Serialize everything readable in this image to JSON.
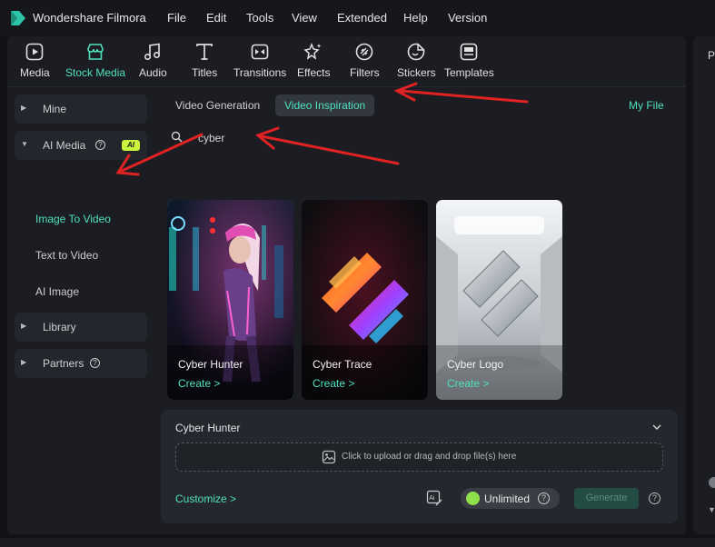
{
  "app": {
    "title": "Wondershare Filmora"
  },
  "menu": [
    "File",
    "Edit",
    "Tools",
    "View",
    "Extended",
    "Help",
    "Version"
  ],
  "toolbar": [
    {
      "label": "Media",
      "icon": "media-icon"
    },
    {
      "label": "Stock Media",
      "icon": "stock-media-icon",
      "active": true
    },
    {
      "label": "Audio",
      "icon": "audio-icon"
    },
    {
      "label": "Titles",
      "icon": "titles-icon"
    },
    {
      "label": "Transitions",
      "icon": "transitions-icon"
    },
    {
      "label": "Effects",
      "icon": "effects-icon"
    },
    {
      "label": "Filters",
      "icon": "filters-icon"
    },
    {
      "label": "Stickers",
      "icon": "stickers-icon"
    },
    {
      "label": "Templates",
      "icon": "templates-icon"
    }
  ],
  "sidebar": {
    "mine": "Mine",
    "ai_media": "AI Media",
    "ai_badge": "AI",
    "sub_items": [
      "Image To Video",
      "Text to Video",
      "AI Image"
    ],
    "library": "Library",
    "partners": "Partners"
  },
  "content": {
    "tabs": [
      "Video Generation",
      "Video Inspiration"
    ],
    "active_tab": "Video Inspiration",
    "my_file": "My File",
    "search_value": "cyber",
    "cards": [
      {
        "title": "Cyber Hunter",
        "action": "Create >"
      },
      {
        "title": "Cyber Trace",
        "action": "Create >"
      },
      {
        "title": "Cyber Logo",
        "action": "Create >"
      }
    ]
  },
  "generator": {
    "title": "Cyber Hunter",
    "upload_text": "Click to upload or drag and drop file(s) here",
    "customize": "Customize >",
    "unlimited": "Unlimited",
    "generate": "Generate"
  },
  "right_panel": {
    "label": "P"
  },
  "colors": {
    "accent": "#4fe0c0",
    "background": "#1b1d22",
    "arrow": "#e02222"
  }
}
